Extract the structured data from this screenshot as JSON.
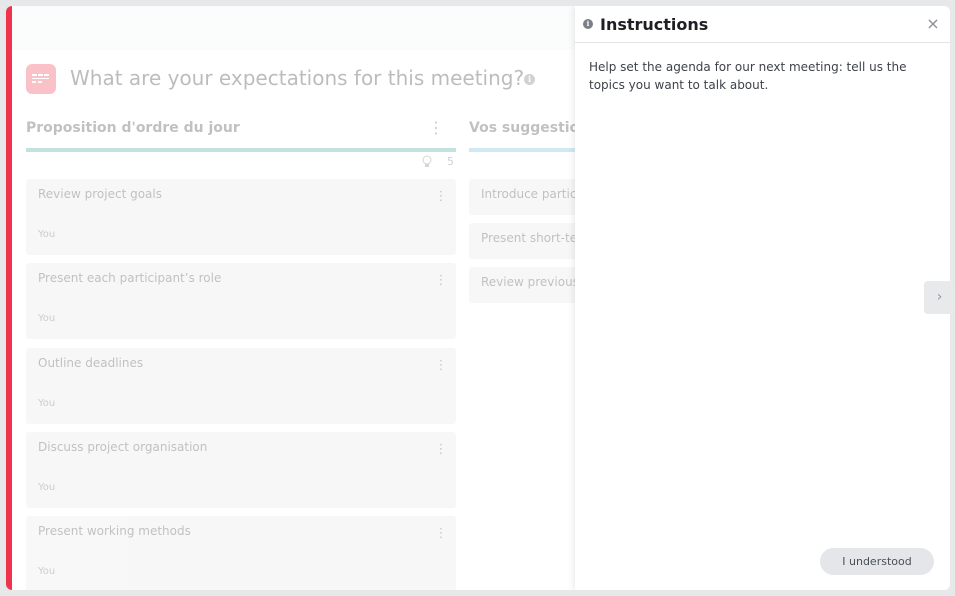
{
  "question": {
    "title": "What are your expectations for this meeting?"
  },
  "columns": [
    {
      "title": "Proposition d'ordre du jour",
      "count": "5",
      "color": "#3b9f96",
      "cards": [
        {
          "title": "Review project goals",
          "author": "You"
        },
        {
          "title": "Present each participant’s role",
          "author": "You"
        },
        {
          "title": "Outline deadlines",
          "author": "You"
        },
        {
          "title": "Discuss project organisation",
          "author": "You"
        },
        {
          "title": "Present working methods",
          "author": "You"
        }
      ]
    },
    {
      "title": "Vos suggestions",
      "color": "#6bb7d6",
      "cards": [
        {
          "title": "Introduce particip"
        },
        {
          "title": "Present short-ter"
        },
        {
          "title": "Review previous p"
        }
      ]
    }
  ],
  "instructions": {
    "title": "Instructions",
    "close_icon": "close-icon",
    "body": "Help set the agenda for our next meeting: tell us the topics you want to talk about.",
    "button_label": "I understood"
  },
  "colors": {
    "accent": "#f0344e",
    "panel_bg": "#ffffff"
  }
}
